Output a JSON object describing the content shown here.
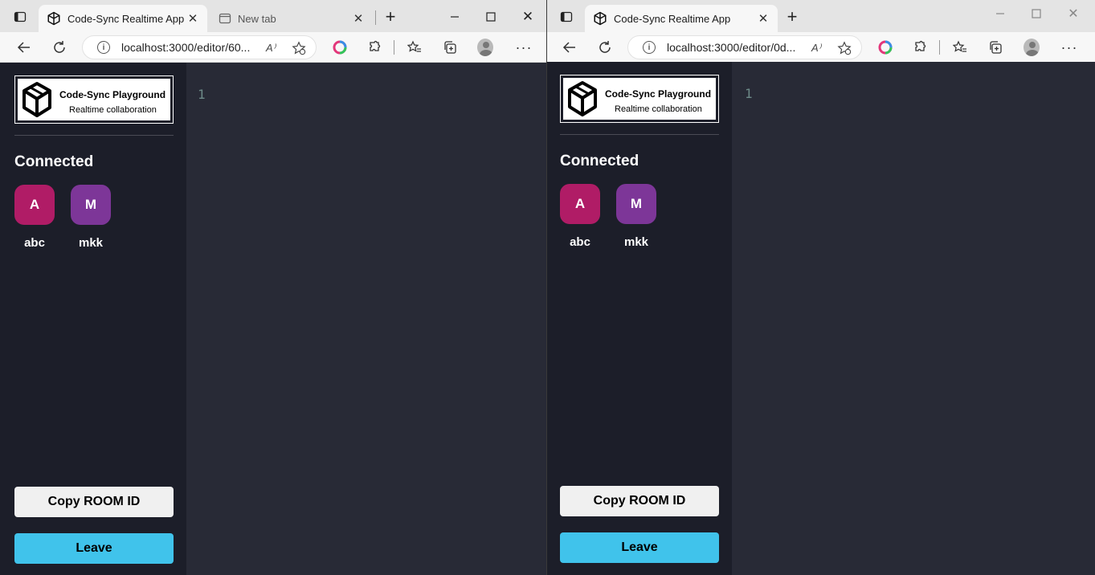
{
  "left_window": {
    "tabs": [
      {
        "label": "Code-Sync Realtime App",
        "active": true
      },
      {
        "label": "New tab",
        "active": false
      }
    ],
    "url": "localhost:3000/editor/60...",
    "app": {
      "logo_title": "Code-Sync Playground",
      "logo_subtitle": "Realtime collaboration",
      "connected_label": "Connected",
      "clients": [
        {
          "initial": "A",
          "name": "abc",
          "color": "#b01c66"
        },
        {
          "initial": "M",
          "name": "mkk",
          "color": "#7d3698"
        }
      ],
      "copy_button": "Copy ROOM ID",
      "leave_button": "Leave",
      "line_number": "1"
    }
  },
  "right_window": {
    "tabs": [
      {
        "label": "Code-Sync Realtime App",
        "active": true
      }
    ],
    "url": "localhost:3000/editor/0d...",
    "app": {
      "logo_title": "Code-Sync Playground",
      "logo_subtitle": "Realtime collaboration",
      "connected_label": "Connected",
      "clients": [
        {
          "initial": "A",
          "name": "abc",
          "color": "#b01c66"
        },
        {
          "initial": "M",
          "name": "mkk",
          "color": "#7d3698"
        }
      ],
      "copy_button": "Copy ROOM ID",
      "leave_button": "Leave",
      "line_number": "1"
    }
  },
  "colors": {
    "sidebar_bg": "#1c1e29",
    "editor_bg": "#282a36",
    "leave_button": "#40c3eb",
    "copy_button": "#f0f0f0"
  },
  "icons": [
    "sidebar-toggle-icon",
    "cube-logo-icon",
    "close-icon",
    "new-tab-icon",
    "plus-icon",
    "minimize-icon",
    "maximize-icon",
    "back-arrow-icon",
    "refresh-icon",
    "info-icon",
    "read-aloud-icon",
    "add-favorite-icon",
    "color-wheel-icon",
    "extensions-icon",
    "favorites-icon",
    "collections-icon",
    "profile-icon",
    "more-icon"
  ]
}
